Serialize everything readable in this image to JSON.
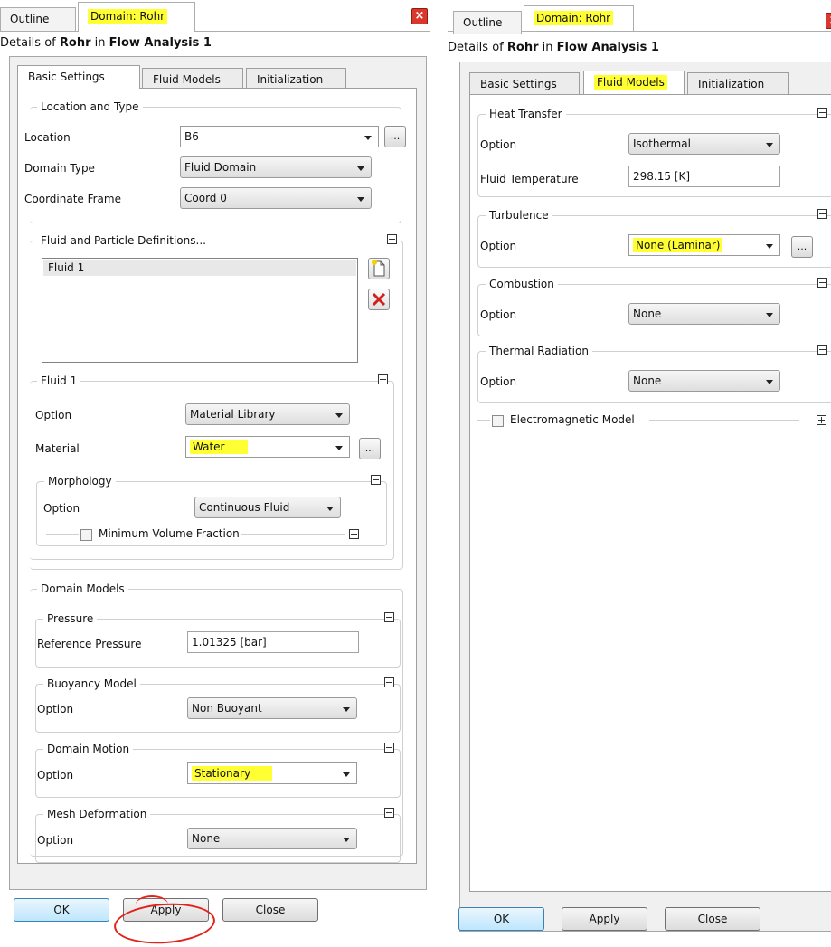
{
  "left": {
    "tabs": {
      "outline": "Outline",
      "domain": "Domain: Rohr"
    },
    "details": {
      "prefix": "Details of ",
      "object": "Rohr",
      "mid": " in ",
      "analysis": "Flow Analysis 1"
    },
    "inner_tabs": {
      "basic": "Basic Settings",
      "fluid": "Fluid Models",
      "init": "Initialization"
    },
    "location_type": {
      "title": "Location and Type",
      "location_label": "Location",
      "location_value": "B6",
      "domain_type_label": "Domain Type",
      "domain_type_value": "Fluid Domain",
      "coord_label": "Coordinate Frame",
      "coord_value": "Coord 0"
    },
    "fluid_defs": {
      "title": "Fluid and Particle Definitions...",
      "list": [
        "Fluid 1"
      ],
      "fluid1": {
        "title": "Fluid 1",
        "option_label": "Option",
        "option_value": "Material Library",
        "material_label": "Material",
        "material_value": "Water",
        "morphology": {
          "title": "Morphology",
          "option_label": "Option",
          "option_value": "Continuous Fluid",
          "min_vol_label": "Minimum Volume Fraction"
        }
      }
    },
    "domain_models": {
      "title": "Domain Models",
      "pressure": {
        "title": "Pressure",
        "ref_label": "Reference Pressure",
        "ref_value": "1.01325 [bar]"
      },
      "buoyancy": {
        "title": "Buoyancy Model",
        "option_label": "Option",
        "option_value": "Non Buoyant"
      },
      "motion": {
        "title": "Domain Motion",
        "option_label": "Option",
        "option_value": "Stationary"
      },
      "mesh": {
        "title": "Mesh Deformation",
        "option_label": "Option",
        "option_value": "None"
      }
    },
    "buttons": {
      "ok": "OK",
      "apply": "Apply",
      "close": "Close"
    }
  },
  "right": {
    "tabs": {
      "outline": "Outline",
      "domain": "Domain: Rohr"
    },
    "details": {
      "prefix": "Details of ",
      "object": "Rohr",
      "mid": " in ",
      "analysis": "Flow Analysis 1"
    },
    "inner_tabs": {
      "basic": "Basic Settings",
      "fluid": "Fluid Models",
      "init": "Initialization"
    },
    "heat_transfer": {
      "title": "Heat Transfer",
      "option_label": "Option",
      "option_value": "Isothermal",
      "temp_label": "Fluid Temperature",
      "temp_value": "298.15 [K]"
    },
    "turbulence": {
      "title": "Turbulence",
      "option_label": "Option",
      "option_value": "None (Laminar)"
    },
    "combustion": {
      "title": "Combustion",
      "option_label": "Option",
      "option_value": "None"
    },
    "radiation": {
      "title": "Thermal Radiation",
      "option_label": "Option",
      "option_value": "None"
    },
    "em_model": {
      "label": "Electromagnetic Model"
    },
    "buttons": {
      "ok": "OK",
      "apply": "Apply",
      "close": "Close"
    }
  },
  "colors": {
    "highlight": "#ffff33",
    "annotation": "#e3211a",
    "default_button": "#bee6fd"
  }
}
